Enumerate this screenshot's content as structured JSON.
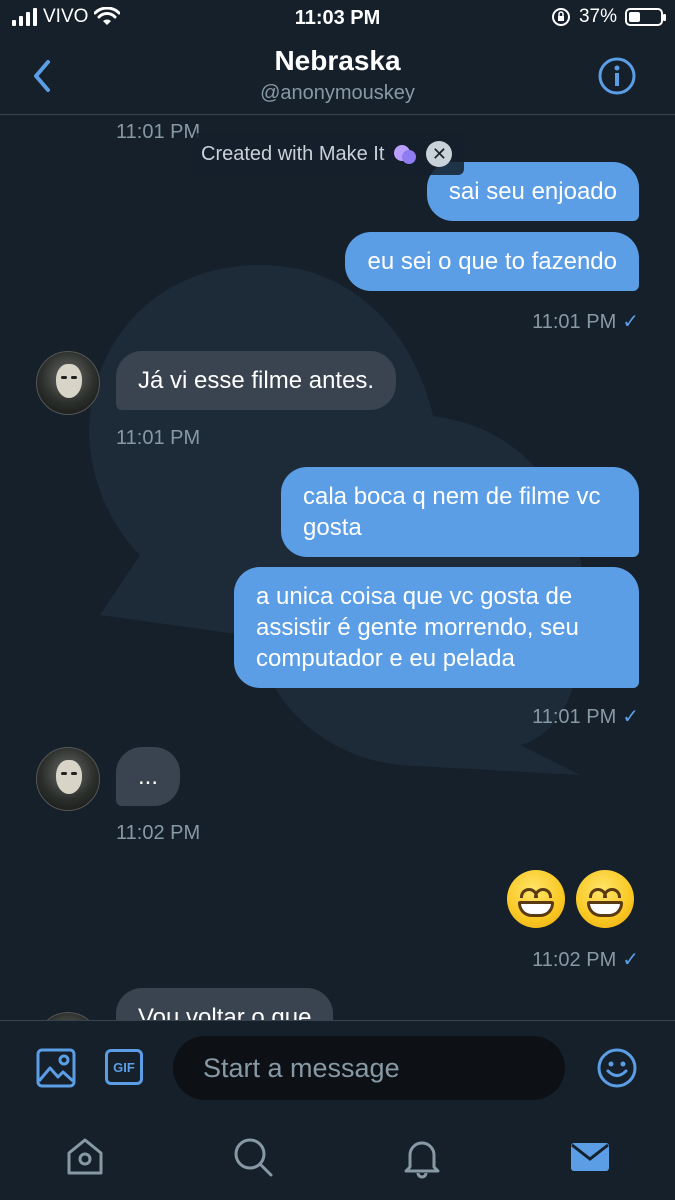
{
  "status_bar": {
    "carrier": "VIVO",
    "time": "11:03 PM",
    "battery": "37%",
    "battery_level": 0.37
  },
  "header": {
    "title": "Nebraska",
    "handle": "@anonymouskey"
  },
  "watermark": {
    "text": "Created with Make It"
  },
  "messages": [
    {
      "side": "in",
      "timestamp": "11:01 PM"
    },
    {
      "side": "out",
      "text": "sai seu enjoado"
    },
    {
      "side": "out",
      "text": "eu sei o que to fazendo",
      "timestamp": "11:01 PM"
    },
    {
      "side": "in",
      "text": "Já vi esse filme antes.",
      "timestamp": "11:01 PM"
    },
    {
      "side": "out",
      "text": "cala boca q nem de filme vc gosta"
    },
    {
      "side": "out",
      "text": "a unica coisa que vc gosta de assistir é gente morrendo, seu computador e eu pelada",
      "timestamp": "11:01 PM"
    },
    {
      "side": "in",
      "text": "...",
      "timestamp": "11:02 PM"
    },
    {
      "side": "out",
      "emoji": "😁 😁",
      "timestamp": "11:02 PM"
    },
    {
      "side": "in",
      "text": "Vou voltar o que"
    }
  ],
  "composer": {
    "placeholder": "Start a message",
    "gif_label": "GIF"
  },
  "colors": {
    "background": "#15202b",
    "outgoing_bubble": "#5b9ee6",
    "incoming_bubble": "#3a4450",
    "accent": "#5b9ee6"
  },
  "icons": {
    "back": "chevron-left-icon",
    "info": "info-icon",
    "image": "image-icon",
    "emoji": "smiley-icon",
    "home": "home-icon",
    "search": "search-icon",
    "notifications": "bell-icon",
    "messages": "mail-icon"
  }
}
